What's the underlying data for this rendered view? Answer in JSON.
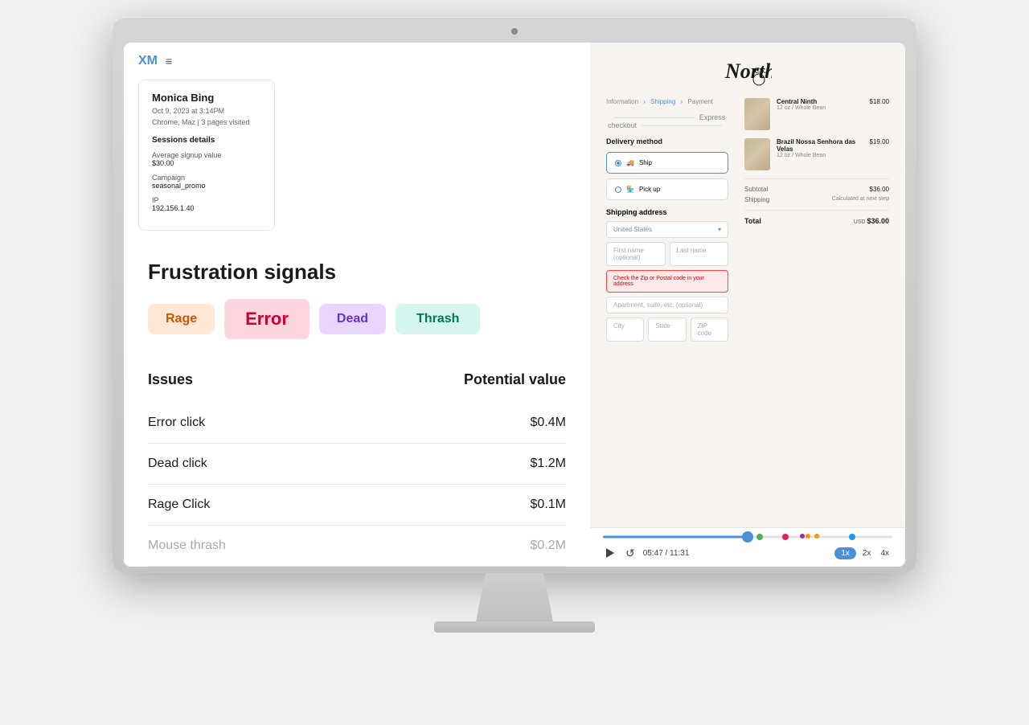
{
  "monitor": {
    "dot": "●"
  },
  "header": {
    "logo": "XM",
    "menu_icon": "≡"
  },
  "session": {
    "name": "Monica Bing",
    "date": "Oct 9, 2023 at 3:14PM",
    "meta": "Chrome, Maz | 3 pages visited",
    "details_title": "Sessions details",
    "avg_signup_label": "Average signup value",
    "avg_signup_value": "$30.00",
    "campaign_label": "Campaign",
    "campaign_value": "seasonal_promo",
    "ip_label": "IP",
    "ip_value": "192.156.1.40"
  },
  "frustration": {
    "title": "Frustration signals",
    "signals": [
      {
        "label": "Rage",
        "style": "rage"
      },
      {
        "label": "Error",
        "style": "error"
      },
      {
        "label": "Dead",
        "style": "dead"
      },
      {
        "label": "Thrash",
        "style": "thrash"
      }
    ]
  },
  "issues": {
    "col1": "Issues",
    "col2": "Potential value",
    "rows": [
      {
        "label": "Error click",
        "value": "$0.4M",
        "faded": false
      },
      {
        "label": "Dead click",
        "value": "$1.2M",
        "faded": false
      },
      {
        "label": "Rage Click",
        "value": "$0.1M",
        "faded": false
      },
      {
        "label": "Mouse thrash",
        "value": "$0.2M",
        "faded": true
      }
    ]
  },
  "checkout": {
    "brand": "North",
    "brand_co": "Co.",
    "breadcrumbs": [
      "Information",
      "Shipping",
      "Payment"
    ],
    "express_label": "Express checkout",
    "delivery_title": "Delivery method",
    "delivery_options": [
      {
        "label": "Ship",
        "selected": true
      },
      {
        "label": "Pick up",
        "selected": false
      }
    ],
    "shipping_title": "Shipping address",
    "country": "United States",
    "first_name_placeholder": "First name (optional)",
    "last_name_placeholder": "Last name",
    "error_message": "Check the Zip or Postal code in your address",
    "apartment_placeholder": "Apartment, suite, etc. (optional)",
    "city_placeholder": "City",
    "state_placeholder": "State",
    "zip_placeholder": "ZIP code"
  },
  "order": {
    "items": [
      {
        "name": "Central Ninth",
        "sub": "12 oz / Whole Bean",
        "price": "$18.00"
      },
      {
        "name": "Brazil Nossa Senhora das Velas",
        "sub": "12 oz / Whole Bean",
        "price": "$19.00"
      }
    ],
    "subtotal_label": "Subtotal",
    "subtotal_value": "$36.00",
    "shipping_label": "Shipping",
    "shipping_value": "Calculated at next step",
    "total_label": "Total",
    "total_currency": "USD",
    "total_value": "$36.00"
  },
  "player": {
    "current_time": "05:47",
    "total_time": "11:31",
    "speed_1x": "1x",
    "speed_2x": "2x",
    "speed_4x": "4x",
    "active_speed": "1x",
    "progress_percent": 50,
    "dots": [
      {
        "color": "#4caf50"
      },
      {
        "color": "#e91e63"
      },
      {
        "color": "#9c27b0"
      },
      {
        "color": "#ff9800"
      },
      {
        "color": "#ff9800"
      },
      {
        "color": "#2196f3"
      }
    ]
  }
}
